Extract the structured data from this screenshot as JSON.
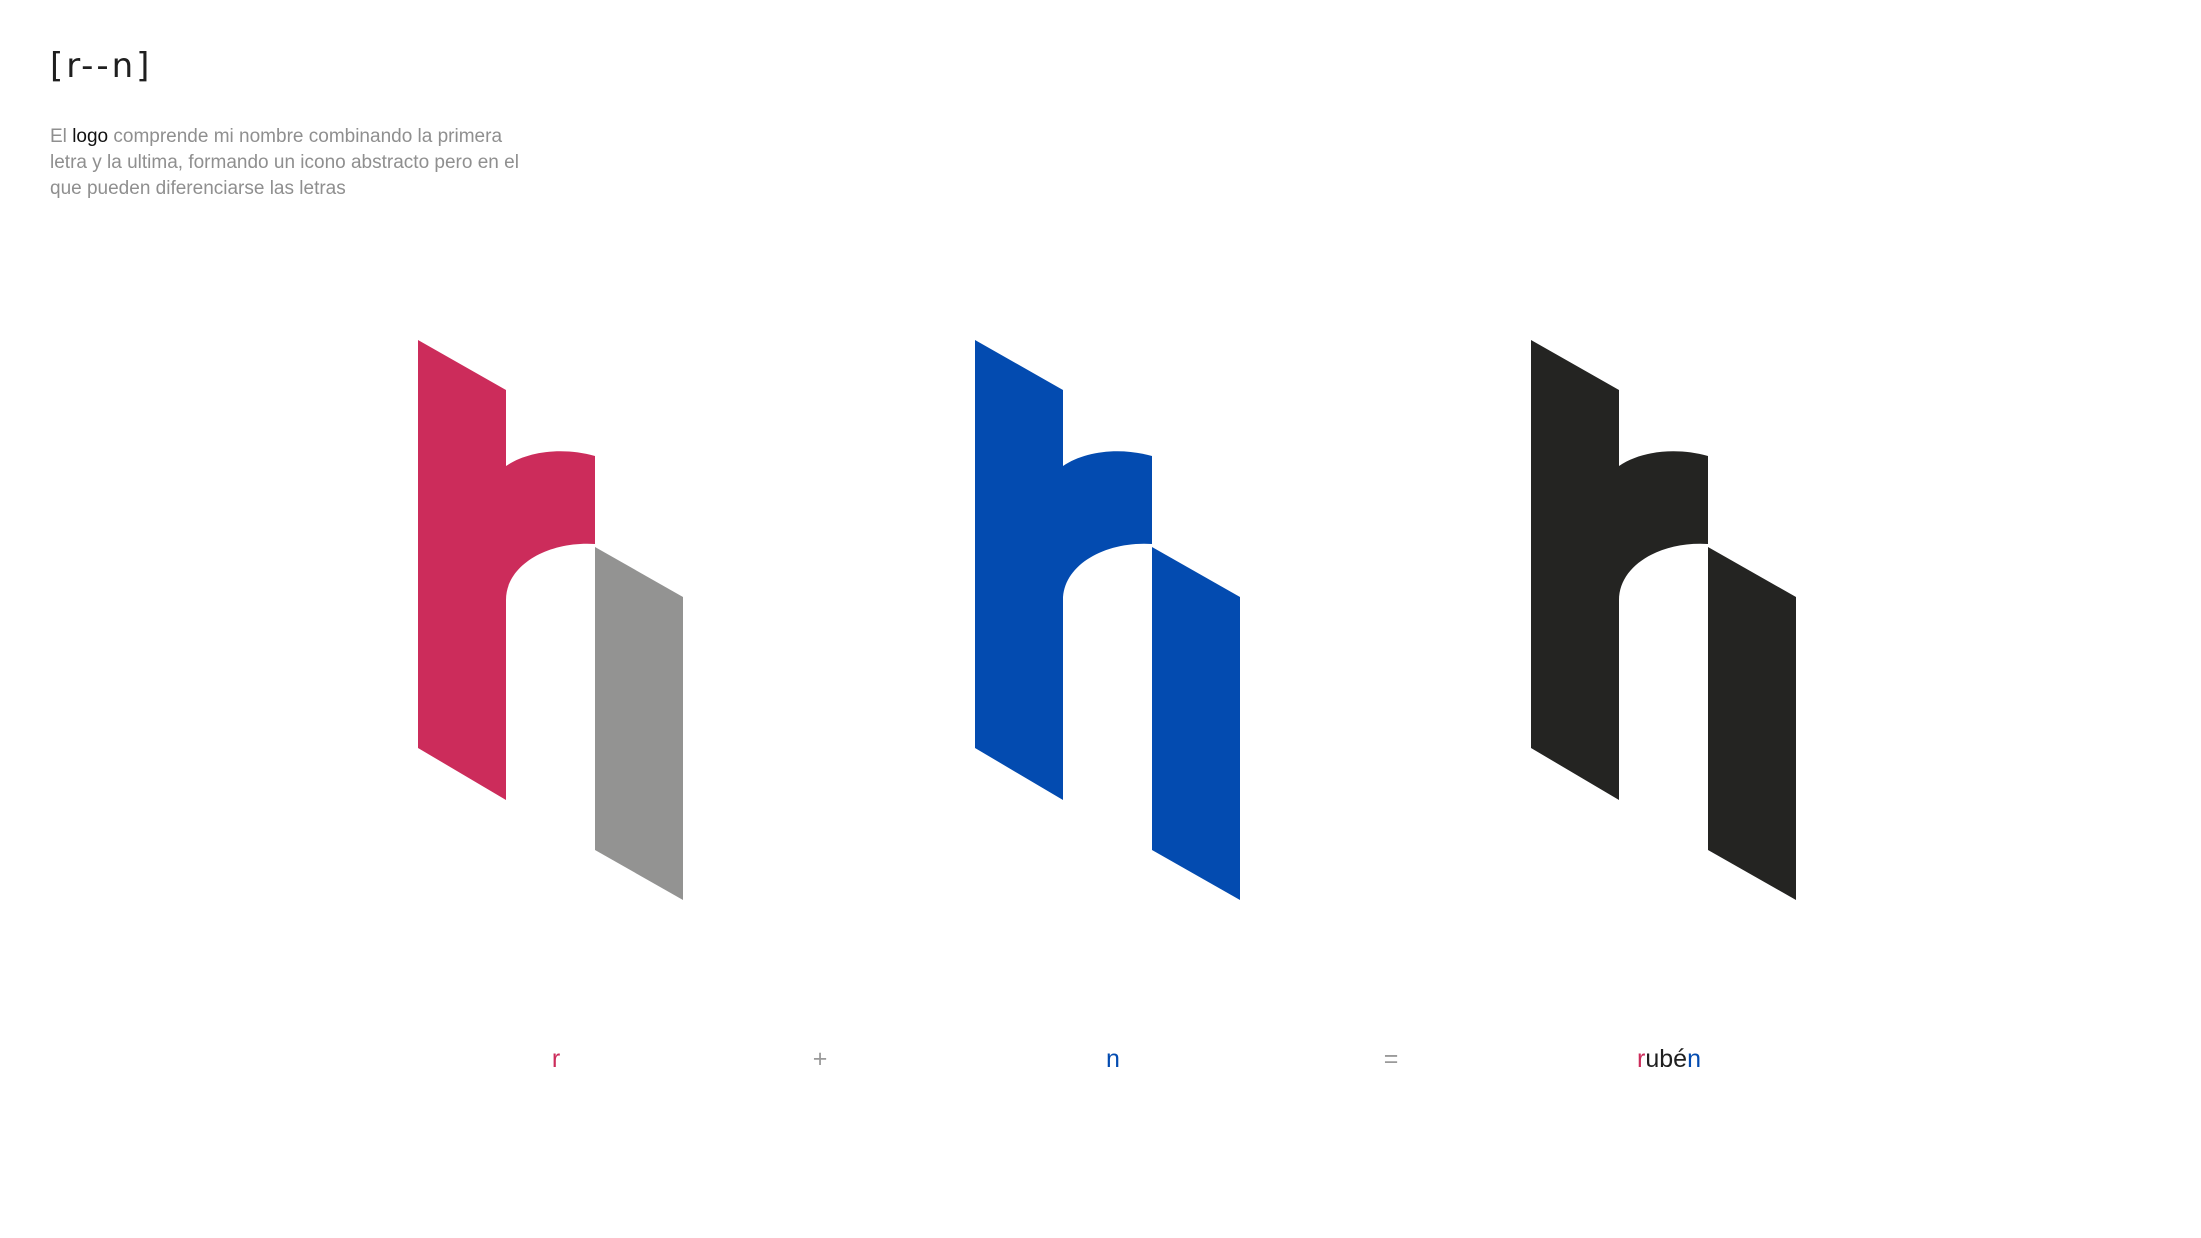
{
  "header": {
    "title": "[r--n]"
  },
  "intro": {
    "text_before": "El ",
    "highlight": "logo",
    "text_after": " comprende mi nombre combinando la primera letra y la ultima, formando un icono abstracto pero en el que pueden diferenciarse las letras"
  },
  "logos": [
    {
      "name": "logo-r-highlighted",
      "r_color": "#cc2c5b",
      "n_color": "#939392"
    },
    {
      "name": "logo-n-highlighted",
      "r_color": "#034bb0",
      "n_color": "#034bb0"
    },
    {
      "name": "logo-combined",
      "r_color": "#242422",
      "n_color": "#242422"
    }
  ],
  "equation": {
    "r": {
      "text": "r",
      "color": "#cc2c5b"
    },
    "plus": "+",
    "n": {
      "text": "n",
      "color": "#034bb0"
    },
    "equals": "=",
    "name": {
      "first": "r",
      "first_color": "#cc2c5b",
      "middle": "ubé",
      "middle_color": "#1f1f1f",
      "last": "n",
      "last_color": "#034bb0"
    }
  }
}
